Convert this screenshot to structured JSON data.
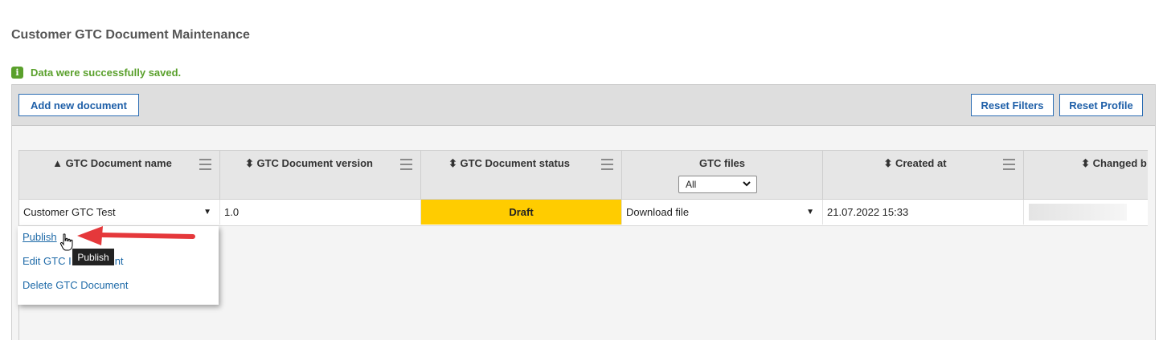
{
  "page": {
    "title": "Customer GTC Document Maintenance"
  },
  "message": {
    "icon": "info-icon",
    "text": "Data were successfully saved."
  },
  "toolbar": {
    "add_label": "Add new document",
    "reset_filters_label": "Reset Filters",
    "reset_profile_label": "Reset Profile"
  },
  "columns": [
    {
      "label": "▲ GTC Document name"
    },
    {
      "label": "⬍ GTC Document version"
    },
    {
      "label": "⬍ GTC Document status"
    },
    {
      "label": "GTC files",
      "filter_value": "All"
    },
    {
      "label": "⬍ Created at"
    },
    {
      "label": "⬍ Changed b"
    }
  ],
  "row": {
    "name": "Customer GTC Test",
    "version": "1.0",
    "status": "Draft",
    "status_color": "#ffcc00",
    "files": "Download file",
    "created": "21.07.2022 15:33"
  },
  "dropdown": {
    "items": [
      "Publish",
      "Edit GTC Document",
      "Delete GTC Document"
    ],
    "edit_visible": "Edit GTC I",
    "edit_tail": "nt"
  },
  "tooltip": {
    "text": "Publish"
  },
  "annotation": {
    "arrow_color": "#e5383b"
  }
}
